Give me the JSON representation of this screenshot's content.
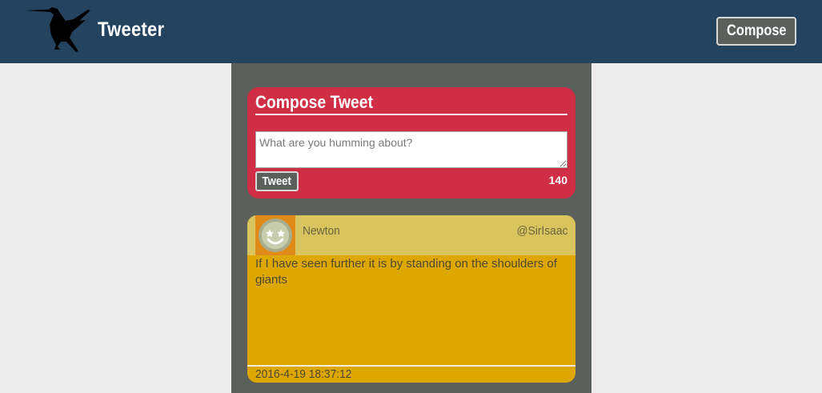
{
  "navbar": {
    "brand": "Tweeter",
    "compose_label": "Compose",
    "logo_icon": "hummingbird-icon",
    "background": "#24435f"
  },
  "compose": {
    "title": "Compose Tweet",
    "placeholder": "What are you humming about?",
    "value": "",
    "tweet_label": "Tweet",
    "char_count": "140",
    "panel_color": "#cf2e44"
  },
  "tweets": [
    {
      "author": "Newton",
      "handle": "@SirIsaac",
      "avatar_icon": "smiley-face-icon",
      "text": "If I have seen further it is by standing on the shoulders of giants",
      "timestamp": "2016-4-19 18:37:12",
      "card_color": "#dea700"
    }
  ],
  "colors": {
    "page_bg": "#ececec",
    "column_bg": "#5b605c",
    "button_bg": "#5b605c"
  }
}
